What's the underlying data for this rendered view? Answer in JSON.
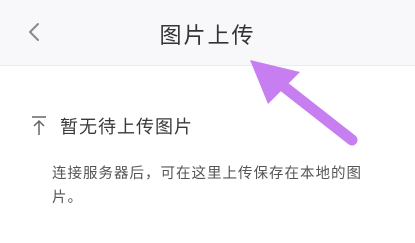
{
  "header": {
    "back_icon": "chevron-left-icon",
    "title": "图片上传"
  },
  "empty_state": {
    "icon": "upload-icon",
    "title": "暂无待上传图片",
    "description": "连接服务器后，可在这里上传保存在本地的图片。"
  },
  "annotation": {
    "arrow_color": "#c77ef0"
  }
}
